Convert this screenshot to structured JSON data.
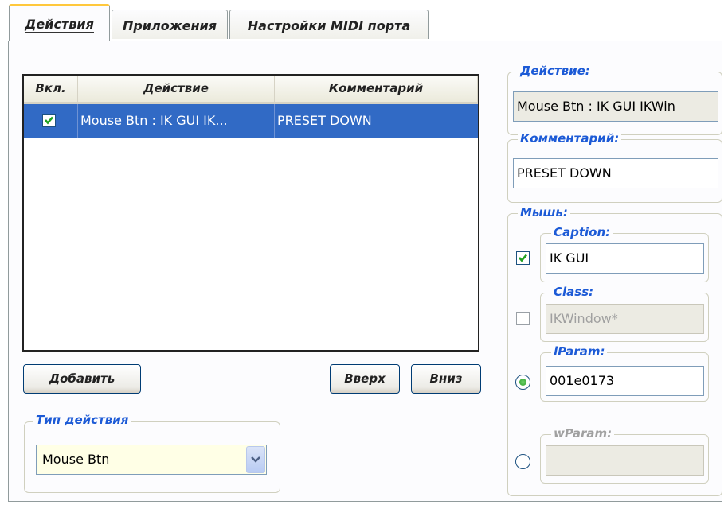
{
  "tabs": [
    {
      "label": "Действия",
      "active": true
    },
    {
      "label": "Приложения",
      "active": false
    },
    {
      "label": "Настройки MIDI порта",
      "active": false
    }
  ],
  "list": {
    "columns": [
      "Вкл.",
      "Действие",
      "Комментарий"
    ],
    "rows": [
      {
        "enabled": true,
        "action": "Mouse Btn : IK GUI IK...",
        "comment": "PRESET DOWN",
        "selected": true
      }
    ]
  },
  "buttons": {
    "add": "Добавить",
    "up": "Вверх",
    "down": "Вниз"
  },
  "action_type": {
    "legend": "Тип действия",
    "value": "Mouse Btn"
  },
  "details": {
    "action_legend": "Действие:",
    "action_value": "Mouse Btn : IK GUI IKWin",
    "comment_legend": "Комментарий:",
    "comment_value": "PRESET DOWN",
    "mouse_legend": "Мышь:",
    "caption_legend": "Caption:",
    "caption_value": "IK GUI",
    "caption_checked": true,
    "class_legend": "Class:",
    "class_value": "IKWindow*",
    "class_checked": false,
    "lparam_legend": "lParam:",
    "lparam_value": "001e0173",
    "lparam_selected": true,
    "wparam_legend": "wParam:",
    "wparam_value": "",
    "wparam_selected": false
  },
  "colors": {
    "selection": "#316ac5",
    "legend_text": "#1c5ad6",
    "active_tab_accent": "#ffc83c",
    "check_green": "#21a121"
  }
}
